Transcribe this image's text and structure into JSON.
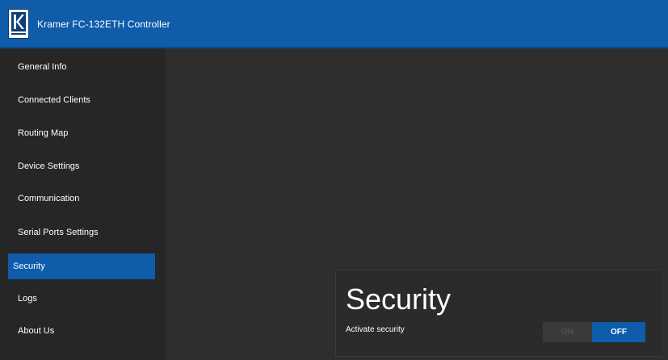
{
  "header": {
    "title": "Kramer FC-132ETH Controller",
    "logo_icon": "kramer-logo-icon",
    "background": "#0f5cab"
  },
  "sidebar": {
    "items": [
      {
        "label": "General Info",
        "active": false
      },
      {
        "label": "Connected Clients",
        "active": false
      },
      {
        "label": "Routing Map",
        "active": false
      },
      {
        "label": "Device Settings",
        "active": false
      },
      {
        "label": "Communication",
        "active": false
      },
      {
        "label": "Serial Ports Settings",
        "active": false
      },
      {
        "label": "Security",
        "active": true
      },
      {
        "label": "Logs",
        "active": false
      },
      {
        "label": "About Us",
        "active": false
      }
    ]
  },
  "security": {
    "title": "Security",
    "activate_label": "Activate security",
    "toggle": {
      "on_label": "ON",
      "off_label": "OFF",
      "value": "OFF"
    }
  },
  "colors": {
    "accent": "#0f5cab",
    "background": "#2e2e2e",
    "sidebar": "#262626"
  }
}
